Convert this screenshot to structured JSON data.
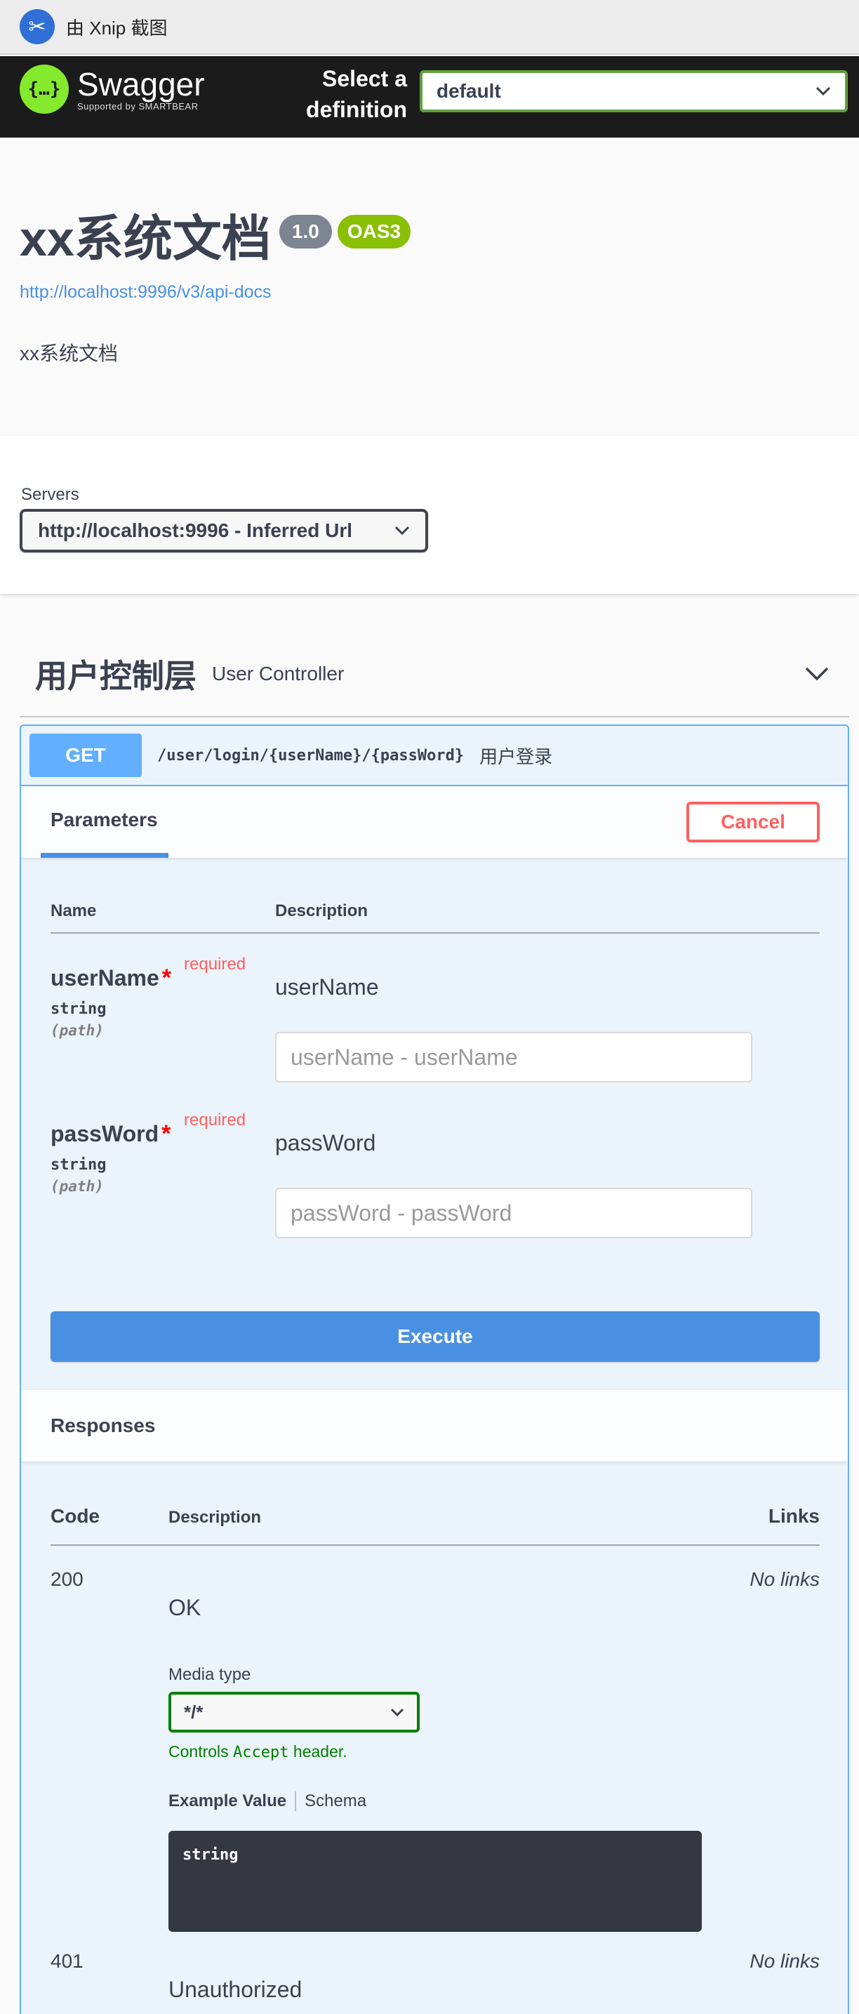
{
  "capture_bar": {
    "text": "由 Xnip 截图"
  },
  "topbar": {
    "brand": "Swagger",
    "brand_sub": "Supported by SMARTBEAR",
    "definition_label": "Select a definition",
    "definition_value": "default"
  },
  "info": {
    "title": "xx系统文档",
    "version": "1.0",
    "oas_badge": "OAS3",
    "api_docs_link": "http://localhost:9996/v3/api-docs",
    "description": "xx系统文档"
  },
  "servers": {
    "label": "Servers",
    "selected": "http://localhost:9996 - Inferred Url"
  },
  "tag": {
    "name": "用户控制层",
    "description": "User Controller"
  },
  "operation": {
    "method": "GET",
    "path": "/user/login/{userName}/{passWord}",
    "summary": "用户登录",
    "parameters_tab": "Parameters",
    "cancel_label": "Cancel",
    "table_headers": {
      "name": "Name",
      "description": "Description"
    },
    "parameters": [
      {
        "name": "userName",
        "required_label": "required",
        "required_mark": "*",
        "type": "string",
        "in": "(path)",
        "description": "userName",
        "placeholder": "userName - userName"
      },
      {
        "name": "passWord",
        "required_label": "required",
        "required_mark": "*",
        "type": "string",
        "in": "(path)",
        "description": "passWord",
        "placeholder": "passWord - passWord"
      }
    ],
    "execute_label": "Execute",
    "responses_title": "Responses",
    "response_headers": {
      "code": "Code",
      "description": "Description",
      "links": "Links"
    },
    "responses": [
      {
        "code": "200",
        "description": "OK",
        "links": "No links",
        "media_type_label": "Media type",
        "media_type_value": "*/*",
        "controls_prefix": "Controls ",
        "controls_code": "Accept",
        "controls_suffix": " header.",
        "example_tab": "Example Value",
        "schema_tab": "Schema",
        "example_body": "string"
      },
      {
        "code": "401",
        "description": "Unauthorized",
        "links": "No links"
      }
    ]
  },
  "colors": {
    "get_accent": "#61affe",
    "execute": "#4990e2",
    "cancel": "#ff6060",
    "oas": "#89bf04",
    "swagger_green": "#85ea2d"
  }
}
